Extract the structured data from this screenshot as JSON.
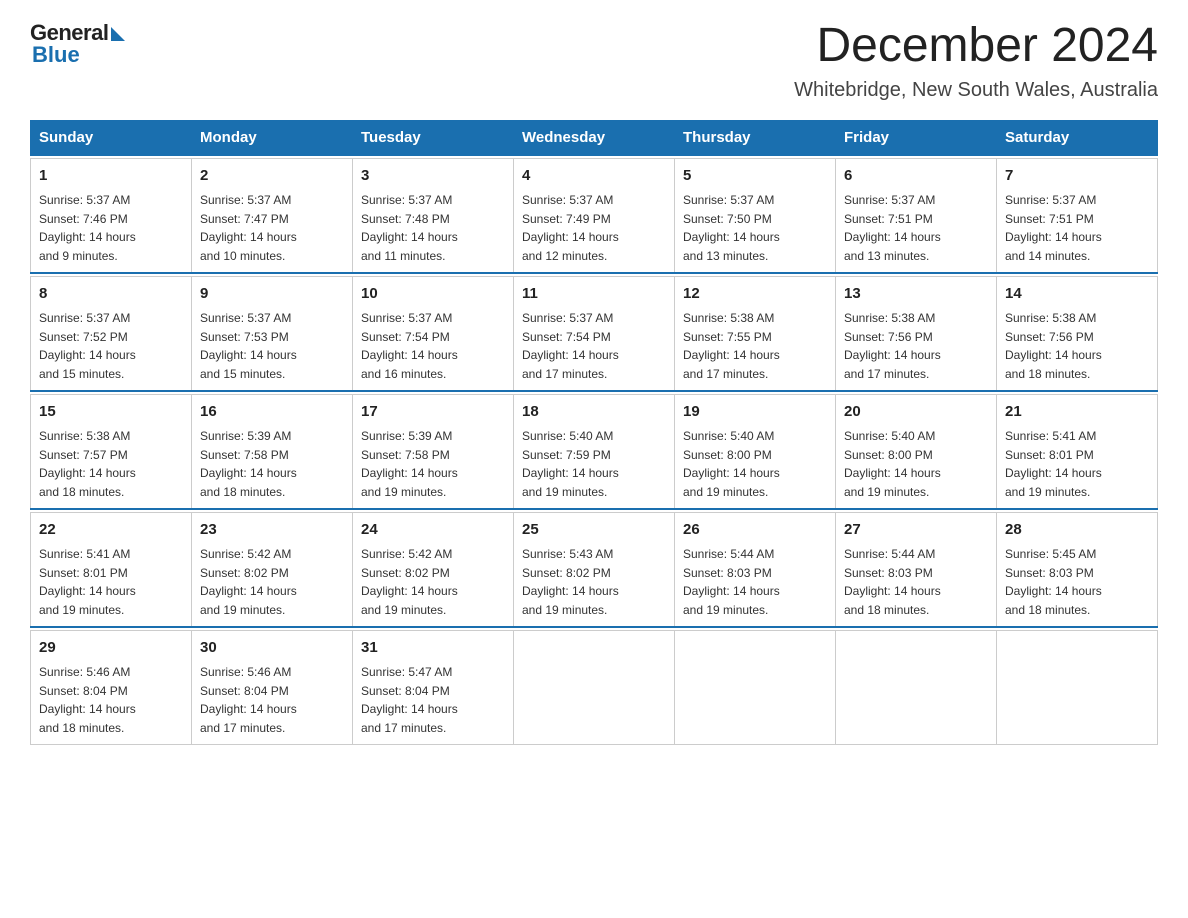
{
  "logo": {
    "general": "General",
    "blue": "Blue"
  },
  "title": "December 2024",
  "location": "Whitebridge, New South Wales, Australia",
  "days_of_week": [
    "Sunday",
    "Monday",
    "Tuesday",
    "Wednesday",
    "Thursday",
    "Friday",
    "Saturday"
  ],
  "weeks": [
    [
      {
        "num": "1",
        "sunrise": "5:37 AM",
        "sunset": "7:46 PM",
        "daylight": "14 hours and 9 minutes."
      },
      {
        "num": "2",
        "sunrise": "5:37 AM",
        "sunset": "7:47 PM",
        "daylight": "14 hours and 10 minutes."
      },
      {
        "num": "3",
        "sunrise": "5:37 AM",
        "sunset": "7:48 PM",
        "daylight": "14 hours and 11 minutes."
      },
      {
        "num": "4",
        "sunrise": "5:37 AM",
        "sunset": "7:49 PM",
        "daylight": "14 hours and 12 minutes."
      },
      {
        "num": "5",
        "sunrise": "5:37 AM",
        "sunset": "7:50 PM",
        "daylight": "14 hours and 13 minutes."
      },
      {
        "num": "6",
        "sunrise": "5:37 AM",
        "sunset": "7:51 PM",
        "daylight": "14 hours and 13 minutes."
      },
      {
        "num": "7",
        "sunrise": "5:37 AM",
        "sunset": "7:51 PM",
        "daylight": "14 hours and 14 minutes."
      }
    ],
    [
      {
        "num": "8",
        "sunrise": "5:37 AM",
        "sunset": "7:52 PM",
        "daylight": "14 hours and 15 minutes."
      },
      {
        "num": "9",
        "sunrise": "5:37 AM",
        "sunset": "7:53 PM",
        "daylight": "14 hours and 15 minutes."
      },
      {
        "num": "10",
        "sunrise": "5:37 AM",
        "sunset": "7:54 PM",
        "daylight": "14 hours and 16 minutes."
      },
      {
        "num": "11",
        "sunrise": "5:37 AM",
        "sunset": "7:54 PM",
        "daylight": "14 hours and 17 minutes."
      },
      {
        "num": "12",
        "sunrise": "5:38 AM",
        "sunset": "7:55 PM",
        "daylight": "14 hours and 17 minutes."
      },
      {
        "num": "13",
        "sunrise": "5:38 AM",
        "sunset": "7:56 PM",
        "daylight": "14 hours and 17 minutes."
      },
      {
        "num": "14",
        "sunrise": "5:38 AM",
        "sunset": "7:56 PM",
        "daylight": "14 hours and 18 minutes."
      }
    ],
    [
      {
        "num": "15",
        "sunrise": "5:38 AM",
        "sunset": "7:57 PM",
        "daylight": "14 hours and 18 minutes."
      },
      {
        "num": "16",
        "sunrise": "5:39 AM",
        "sunset": "7:58 PM",
        "daylight": "14 hours and 18 minutes."
      },
      {
        "num": "17",
        "sunrise": "5:39 AM",
        "sunset": "7:58 PM",
        "daylight": "14 hours and 19 minutes."
      },
      {
        "num": "18",
        "sunrise": "5:40 AM",
        "sunset": "7:59 PM",
        "daylight": "14 hours and 19 minutes."
      },
      {
        "num": "19",
        "sunrise": "5:40 AM",
        "sunset": "8:00 PM",
        "daylight": "14 hours and 19 minutes."
      },
      {
        "num": "20",
        "sunrise": "5:40 AM",
        "sunset": "8:00 PM",
        "daylight": "14 hours and 19 minutes."
      },
      {
        "num": "21",
        "sunrise": "5:41 AM",
        "sunset": "8:01 PM",
        "daylight": "14 hours and 19 minutes."
      }
    ],
    [
      {
        "num": "22",
        "sunrise": "5:41 AM",
        "sunset": "8:01 PM",
        "daylight": "14 hours and 19 minutes."
      },
      {
        "num": "23",
        "sunrise": "5:42 AM",
        "sunset": "8:02 PM",
        "daylight": "14 hours and 19 minutes."
      },
      {
        "num": "24",
        "sunrise": "5:42 AM",
        "sunset": "8:02 PM",
        "daylight": "14 hours and 19 minutes."
      },
      {
        "num": "25",
        "sunrise": "5:43 AM",
        "sunset": "8:02 PM",
        "daylight": "14 hours and 19 minutes."
      },
      {
        "num": "26",
        "sunrise": "5:44 AM",
        "sunset": "8:03 PM",
        "daylight": "14 hours and 19 minutes."
      },
      {
        "num": "27",
        "sunrise": "5:44 AM",
        "sunset": "8:03 PM",
        "daylight": "14 hours and 18 minutes."
      },
      {
        "num": "28",
        "sunrise": "5:45 AM",
        "sunset": "8:03 PM",
        "daylight": "14 hours and 18 minutes."
      }
    ],
    [
      {
        "num": "29",
        "sunrise": "5:46 AM",
        "sunset": "8:04 PM",
        "daylight": "14 hours and 18 minutes."
      },
      {
        "num": "30",
        "sunrise": "5:46 AM",
        "sunset": "8:04 PM",
        "daylight": "14 hours and 17 minutes."
      },
      {
        "num": "31",
        "sunrise": "5:47 AM",
        "sunset": "8:04 PM",
        "daylight": "14 hours and 17 minutes."
      },
      null,
      null,
      null,
      null
    ]
  ],
  "labels": {
    "sunrise": "Sunrise:",
    "sunset": "Sunset:",
    "daylight": "Daylight:"
  }
}
